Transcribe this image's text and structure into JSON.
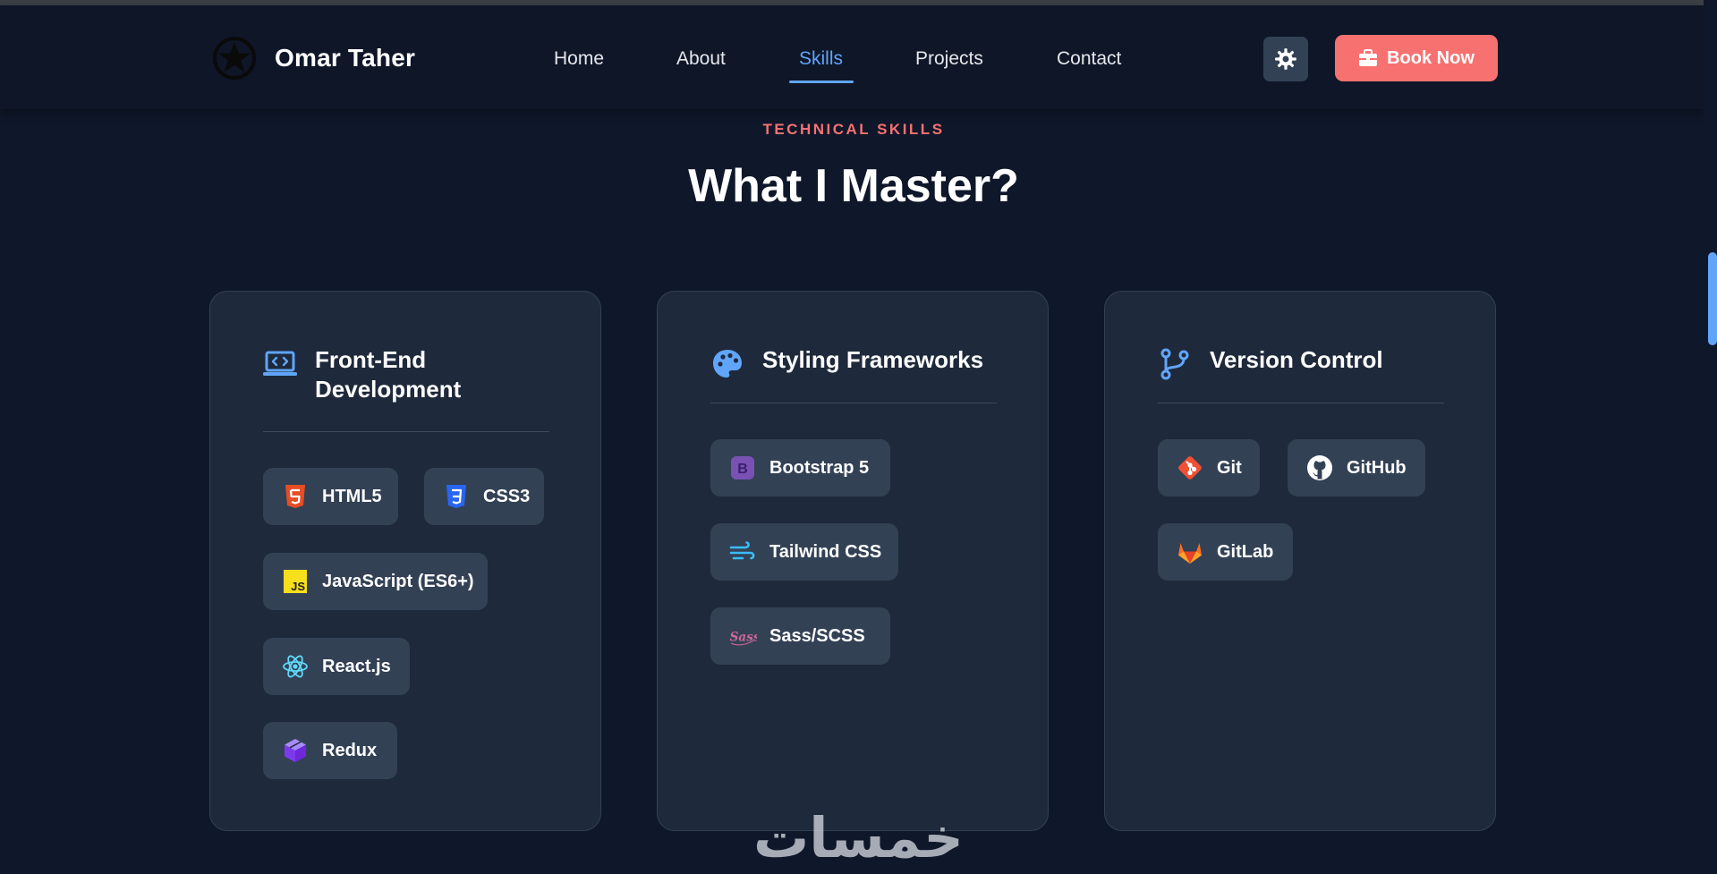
{
  "brand": {
    "name": "Omar Taher",
    "logo_icon": "star-badge-icon"
  },
  "nav": {
    "links": [
      {
        "label": "Home"
      },
      {
        "label": "About"
      },
      {
        "label": "Skills",
        "active": true
      },
      {
        "label": "Projects"
      },
      {
        "label": "Contact"
      }
    ],
    "theme_toggle_icon": "gear-icon",
    "book_button": {
      "label": "Book Now",
      "icon": "briefcase-icon"
    }
  },
  "section": {
    "eyebrow": "TECHNICAL SKILLS",
    "title": "What I Master?"
  },
  "cards": [
    {
      "title": "Front-End Development",
      "icon": "laptop-code-icon",
      "skills": [
        {
          "label": "HTML5",
          "icon": "html5-icon"
        },
        {
          "label": "CSS3",
          "icon": "css3-icon"
        },
        {
          "label": "JavaScript (ES6+)",
          "icon": "javascript-icon"
        },
        {
          "label": "React.js",
          "icon": "react-icon"
        },
        {
          "label": "Redux",
          "icon": "redux-cube-icon"
        }
      ]
    },
    {
      "title": "Styling Frameworks",
      "icon": "palette-icon",
      "skills": [
        {
          "label": "Bootstrap 5",
          "icon": "bootstrap-icon"
        },
        {
          "label": "Tailwind CSS",
          "icon": "tailwind-wind-icon"
        },
        {
          "label": "Sass/SCSS",
          "icon": "sass-icon"
        }
      ]
    },
    {
      "title": "Version Control",
      "icon": "code-branch-icon",
      "skills": [
        {
          "label": "Git",
          "icon": "git-icon"
        },
        {
          "label": "GitHub",
          "icon": "github-icon"
        },
        {
          "label": "GitLab",
          "icon": "gitlab-icon"
        }
      ]
    }
  ],
  "watermark": "خمسات",
  "colors": {
    "background": "#0f172a",
    "card": "#1e293b",
    "chip": "#334155",
    "accent_blue": "#60a5fa",
    "accent_coral": "#f87171"
  }
}
